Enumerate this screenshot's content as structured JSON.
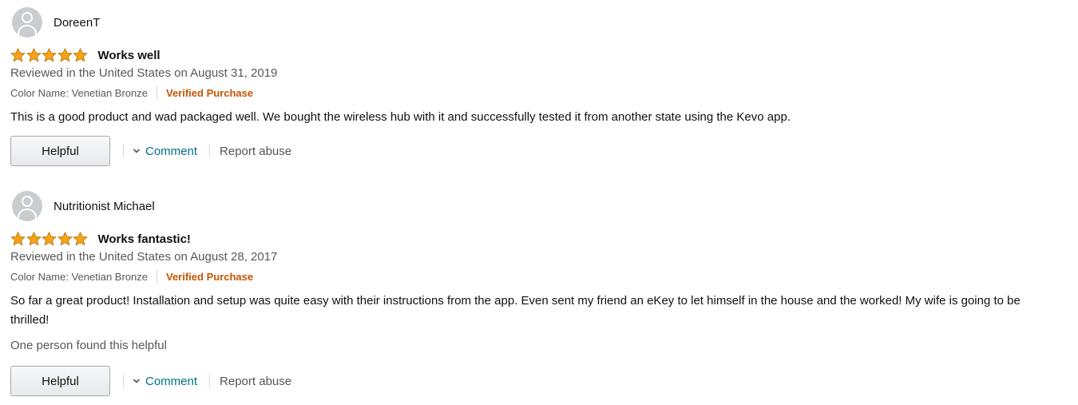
{
  "colors": {
    "star": "#f7a31c",
    "verified_purchase": "#c45500",
    "link": "#007185",
    "secondary_text": "#565959"
  },
  "reviews": [
    {
      "reviewer": "DoreenT",
      "rating": 5,
      "max_rating": 5,
      "title": "Works well",
      "date_line": "Reviewed in the United States on August 31, 2019",
      "color_name": "Color Name: Venetian Bronze",
      "badge": "Verified Purchase",
      "body": "This is a good product and wad packaged well. We bought the wireless hub with it and successfully tested it from another state using the Kevo app.",
      "helpful_count": "",
      "helpful_label": "Helpful",
      "comment_label": "Comment",
      "report_label": "Report abuse"
    },
    {
      "reviewer": "Nutritionist Michael",
      "rating": 5,
      "max_rating": 5,
      "title": "Works fantastic!",
      "date_line": "Reviewed in the United States on August 28, 2017",
      "color_name": "Color Name: Venetian Bronze",
      "badge": "Verified Purchase",
      "body": "So far a great product! Installation and setup was quite easy with their instructions from the app. Even sent my friend an eKey to let himself in the house and the worked! My wife is going to be thrilled!",
      "helpful_count": "One person found this helpful",
      "helpful_label": "Helpful",
      "comment_label": "Comment",
      "report_label": "Report abuse"
    }
  ]
}
